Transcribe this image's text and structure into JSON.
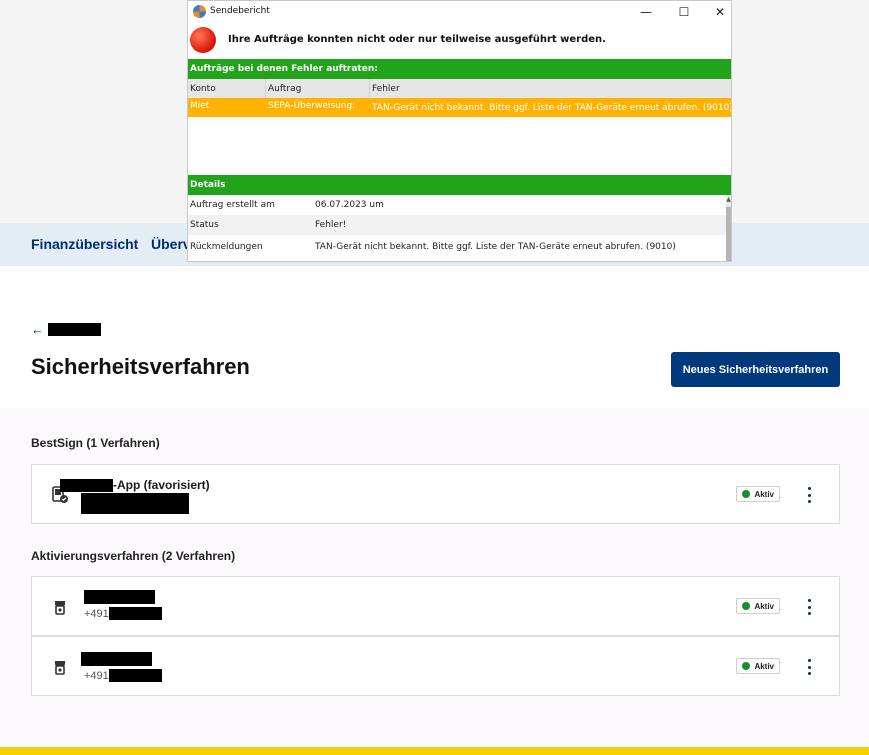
{
  "dialog": {
    "title": "Sendebericht",
    "heading": "Ihre Aufträge konnten nicht oder nur teilweise ausgeführt werden.",
    "errors_header": "Aufträge bei denen Fehler auftraten:",
    "columns": [
      "Konto",
      "Auftrag",
      "Fehler"
    ],
    "error_row": {
      "konto": "Miet",
      "auftrag": "SEPA-Überweisung:",
      "fehler": "TAN-Gerät nicht bekannt. Bitte ggf. Liste der TAN-Geräte erneut abrufen. (9010)"
    },
    "details_header": "Details",
    "details": [
      {
        "key": "Auftrag erstellt am",
        "value": "06.07.2023 um"
      },
      {
        "key": "Status",
        "value": "Fehler!"
      },
      {
        "key": "Rückmeldungen",
        "value": "TAN-Gerät nicht bekannt. Bitte ggf. Liste der TAN-Geräte erneut abrufen. (9010)"
      }
    ],
    "window_buttons": {
      "minimize": "—",
      "maximize": "☐",
      "close": "✕"
    }
  },
  "nav": {
    "items": [
      "Finanzübersicht",
      "Überv"
    ]
  },
  "page": {
    "back_arrow": "←",
    "title": "Sicherheitsverfahren",
    "new_button": "Neues Sicherheitsverfahren"
  },
  "sections": {
    "bestsign": {
      "title": "BestSign (1 Verfahren)",
      "item": {
        "name_suffix": "-App (favorisiert)",
        "status": "Aktiv"
      }
    },
    "aktivierung": {
      "title": "Aktivierungsverfahren (2 Verfahren)",
      "items": [
        {
          "phone_prefix": "+491",
          "status": "Aktiv"
        },
        {
          "phone_prefix": "+491",
          "status": "Aktiv"
        }
      ]
    }
  },
  "colors": {
    "green": "#21a31a",
    "error_orange": "#ffb300",
    "navy": "#003a7d",
    "active_dot": "#1e8a2e",
    "yellow": "#f5d100"
  },
  "icons": {
    "app": "app-icon",
    "error": "error-icon",
    "device": "device-check-icon",
    "phone": "phone-icon",
    "more": "kebab-menu-icon"
  }
}
